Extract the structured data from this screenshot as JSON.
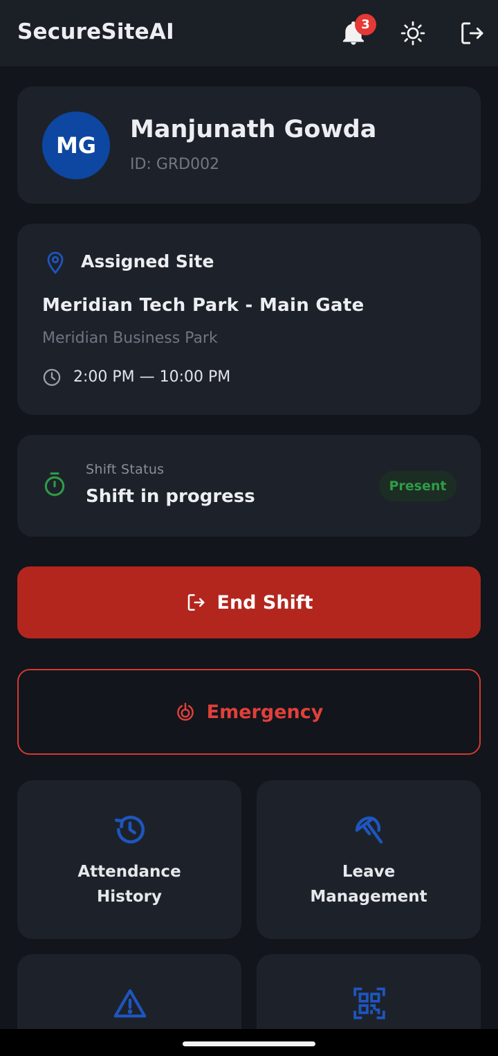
{
  "app": {
    "title": "SecureSiteAI",
    "notification_count": "3",
    "icons": [
      "bell-icon",
      "sun-icon",
      "logout-icon"
    ]
  },
  "profile": {
    "initials": "MG",
    "name": "Manjunath Gowda",
    "id": "ID: GRD002"
  },
  "site": {
    "header": "Assigned Site",
    "name": "Meridian Tech Park - Main Gate",
    "location": "Meridian Business Park",
    "shift_time": "2:00 PM — 10:00 PM"
  },
  "status": {
    "label": "Shift Status",
    "text": "Shift in progress",
    "badge": "Present"
  },
  "actions": {
    "end_shift": "End Shift",
    "emergency": "Emergency"
  },
  "tiles": [
    {
      "line1": "Attendance",
      "line2": "History",
      "icon": "history-icon"
    },
    {
      "line1": "Leave",
      "line2": "Management",
      "icon": "beach-umbrella-icon"
    },
    {
      "icon": "warning-icon"
    },
    {
      "icon": "qr-code-icon"
    }
  ],
  "colors": {
    "accent_blue": "#1e56c0",
    "danger": "#b3261e",
    "success": "#2e9d47",
    "card": "#1d222a",
    "background": "#12151b"
  }
}
